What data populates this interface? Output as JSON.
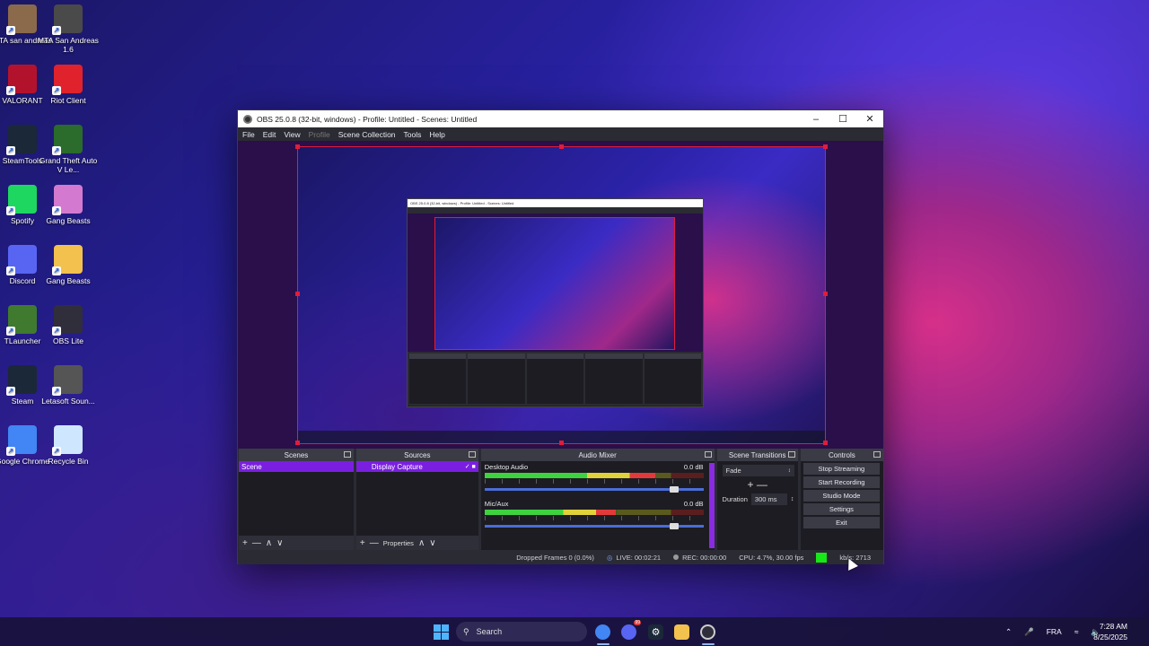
{
  "desktop_icons": [
    {
      "label": "GTA san andreas",
      "icon": "gta-sa-icon",
      "color": "#8a6a4a"
    },
    {
      "label": "MTA San Andreas 1.6",
      "icon": "mta-icon",
      "color": "#4a4a4a"
    },
    {
      "label": "VALORANT",
      "icon": "valorant-icon",
      "color": "#b3122d"
    },
    {
      "label": "Riot Client",
      "icon": "riot-client-icon",
      "color": "#e0222d"
    },
    {
      "label": "SteamTools",
      "icon": "steamtools-icon",
      "color": "#1b2838"
    },
    {
      "label": "Grand Theft Auto V Le...",
      "icon": "gta-v-icon",
      "color": "#2b6b2b"
    },
    {
      "label": "Spotify",
      "icon": "spotify-icon",
      "color": "#1ed760"
    },
    {
      "label": "Gang Beasts",
      "icon": "gang-beasts-icon",
      "color": "#d37ad0"
    },
    {
      "label": "Discord",
      "icon": "discord-icon",
      "color": "#5865f2"
    },
    {
      "label": "Gang Beasts",
      "icon": "folder-icon",
      "color": "#f2c14e"
    },
    {
      "label": "TLauncher",
      "icon": "tlauncher-icon",
      "color": "#3f7a2e"
    },
    {
      "label": "OBS Lite",
      "icon": "obs-lite-icon",
      "color": "#302e3a"
    },
    {
      "label": "Steam",
      "icon": "steam-icon",
      "color": "#1b2838"
    },
    {
      "label": "Letasoft Soun...",
      "icon": "letasoft-icon",
      "color": "#555555"
    },
    {
      "label": "Google Chrome",
      "icon": "chrome-icon",
      "color": "#4285f4"
    },
    {
      "label": "Recycle Bin",
      "icon": "recycle-bin-icon",
      "color": "#cfe6ff"
    }
  ],
  "obs": {
    "title": "OBS 25.0.8 (32-bit, windows) - Profile: Untitled - Scenes: Untitled",
    "menu": [
      "File",
      "Edit",
      "View",
      "Profile",
      "Scene Collection",
      "Tools",
      "Help"
    ],
    "docks": {
      "scenes": {
        "title": "Scenes",
        "items": [
          "Scene"
        ],
        "footer": [
          "+",
          "—",
          "∧",
          "∨"
        ]
      },
      "sources": {
        "title": "Sources",
        "items": [
          "Display Capture"
        ],
        "footer": [
          "+",
          "—",
          "Properties",
          "∧",
          "∨"
        ]
      },
      "mixer": {
        "title": "Audio Mixer",
        "channels": [
          {
            "name": "Desktop Audio",
            "db": "0.0 dB",
            "level": 0.78,
            "volume": 0.88
          },
          {
            "name": "Mic/Aux",
            "db": "0.0 dB",
            "level": 0.6,
            "volume": 0.88
          }
        ]
      },
      "transitions": {
        "title": "Scene Transitions",
        "selected": "Fade",
        "plus": "+",
        "minus": "—",
        "duration_label": "Duration",
        "duration_value": "300 ms"
      },
      "controls": {
        "title": "Controls",
        "buttons": [
          "Stop Streaming",
          "Start Recording",
          "Studio Mode",
          "Settings",
          "Exit"
        ]
      }
    },
    "status": {
      "dropped": "Dropped Frames 0 (0.0%)",
      "live": "LIVE: 00:02:21",
      "rec": "REC: 00:00:00",
      "cpu": "CPU: 4.7%, 30.00 fps",
      "kbs": "kb/s: 2713",
      "health_color": "#17e817"
    }
  },
  "taskbar": {
    "search_placeholder": "Search",
    "language": "FRA",
    "time": "7:28 AM",
    "date": "8/25/2025",
    "discord_badge": "99"
  }
}
